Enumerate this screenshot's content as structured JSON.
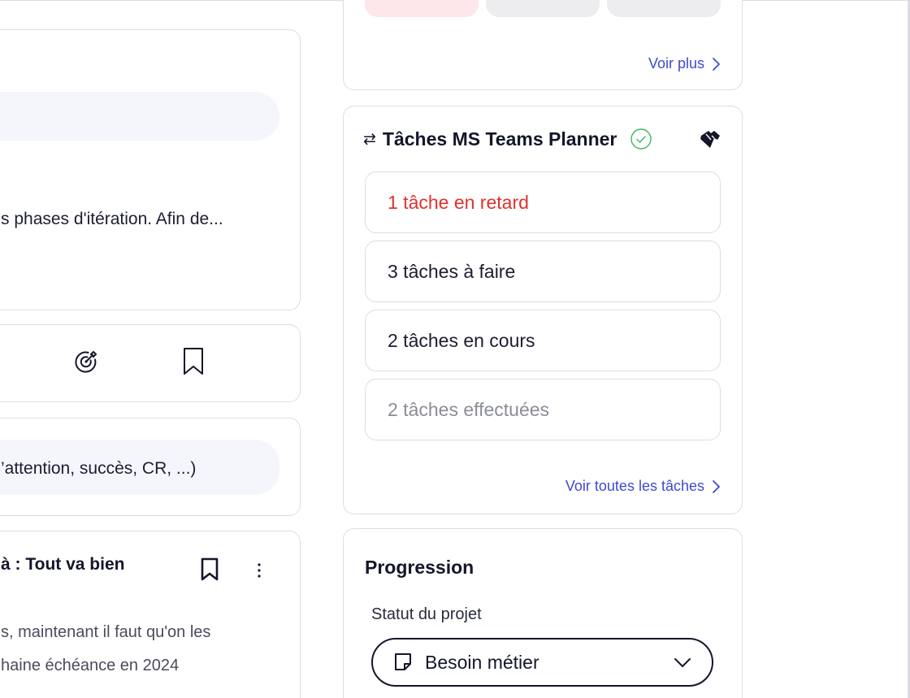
{
  "left_column": {
    "card1_text": "s phases d'itération. Afin de...",
    "card3_pill_text": "’attention, succès, CR, ...)",
    "card4_title": "à : Tout va bien",
    "card4_line1": "s, maintenant il faut qu'on les",
    "card4_line2": "haine échéance en 2024"
  },
  "top_card": {
    "voir_plus": "Voir plus"
  },
  "tasks_card": {
    "title": "Tâches MS Teams Planner",
    "sync_symbol": "⇄",
    "rows": [
      {
        "label": "1 tâche en retard",
        "status": "late"
      },
      {
        "label": "3 tâches à faire",
        "status": "todo"
      },
      {
        "label": "2 tâches en cours",
        "status": "in-progress"
      },
      {
        "label": "2 tâches effectuées",
        "status": "done"
      }
    ],
    "voir_toutes": "Voir toutes les tâches"
  },
  "progression": {
    "title": "Progression",
    "statut_label": "Statut du projet",
    "statut_value": "Besoin métier"
  },
  "colors": {
    "accent": "#3e4ad0",
    "late": "#e0322f",
    "success": "#3cb95c",
    "done_text": "#8a8c98"
  }
}
